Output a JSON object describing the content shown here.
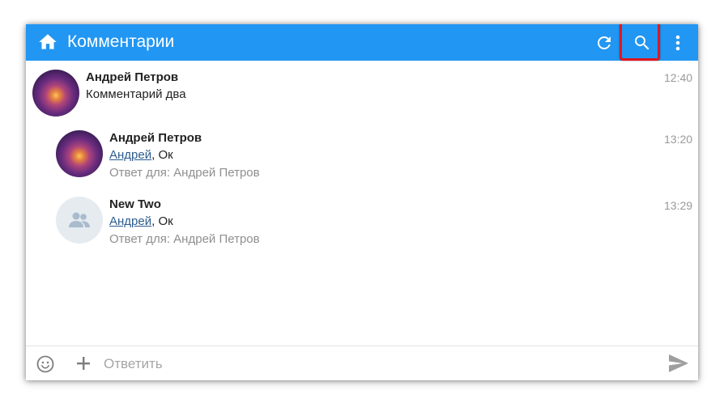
{
  "appbar": {
    "title": "Комментарии",
    "color": "#2196f3",
    "icons": {
      "home": "home-icon",
      "refresh": "refresh-icon",
      "search": "search-icon",
      "menu": "more-vertical-icon"
    }
  },
  "comments": [
    {
      "author": "Андрей Петров",
      "text": "Комментарий два",
      "time": "12:40",
      "avatar": "photo"
    },
    {
      "author": "Андрей Петров",
      "mention": "Андрей",
      "text_suffix": ", Ок",
      "reply_to": "Ответ для: Андрей Петров",
      "time": "13:20",
      "avatar": "photo"
    },
    {
      "author": "New Two",
      "mention": "Андрей",
      "text_suffix": ", Ок",
      "reply_to": "Ответ для: Андрей Петров",
      "time": "13:29",
      "avatar": "group-placeholder-icon"
    }
  ],
  "compose": {
    "placeholder": "Ответить",
    "icons": {
      "emoji": "emoji-icon",
      "attach": "plus-icon",
      "send": "send-icon"
    }
  },
  "highlight_color": "#e0161d"
}
